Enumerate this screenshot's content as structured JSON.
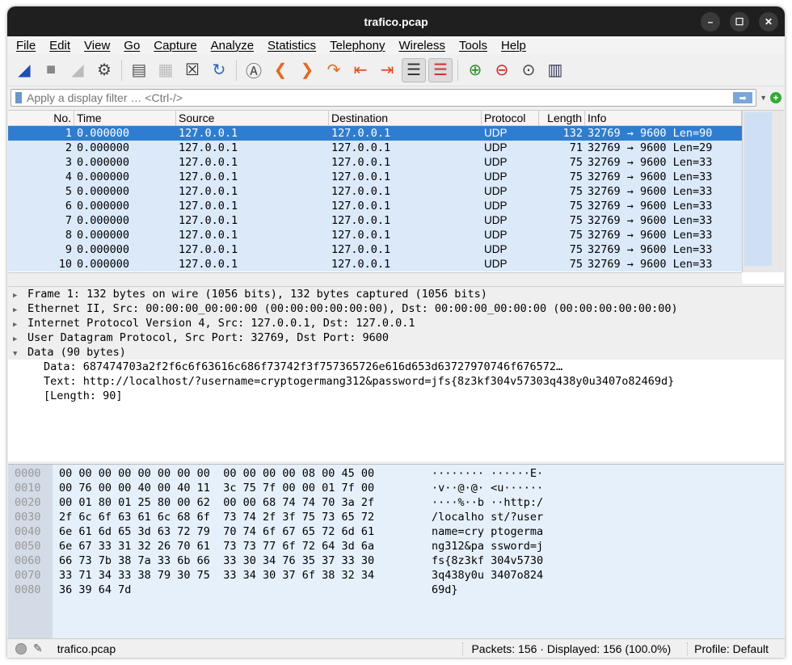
{
  "window": {
    "title": "trafico.pcap"
  },
  "menu": [
    "File",
    "Edit",
    "View",
    "Go",
    "Capture",
    "Analyze",
    "Statistics",
    "Telephony",
    "Wireless",
    "Tools",
    "Help"
  ],
  "filter": {
    "placeholder": "Apply a display filter … <Ctrl-/>"
  },
  "columns": [
    "No.",
    "Time",
    "Source",
    "Destination",
    "Protocol",
    "Length",
    "Info"
  ],
  "packets": [
    [
      "1",
      "0.000000",
      "127.0.0.1",
      "127.0.0.1",
      "UDP",
      "132",
      "32769 → 9600 Len=90"
    ],
    [
      "2",
      "0.000000",
      "127.0.0.1",
      "127.0.0.1",
      "UDP",
      "71",
      "32769 → 9600 Len=29"
    ],
    [
      "3",
      "0.000000",
      "127.0.0.1",
      "127.0.0.1",
      "UDP",
      "75",
      "32769 → 9600 Len=33"
    ],
    [
      "4",
      "0.000000",
      "127.0.0.1",
      "127.0.0.1",
      "UDP",
      "75",
      "32769 → 9600 Len=33"
    ],
    [
      "5",
      "0.000000",
      "127.0.0.1",
      "127.0.0.1",
      "UDP",
      "75",
      "32769 → 9600 Len=33"
    ],
    [
      "6",
      "0.000000",
      "127.0.0.1",
      "127.0.0.1",
      "UDP",
      "75",
      "32769 → 9600 Len=33"
    ],
    [
      "7",
      "0.000000",
      "127.0.0.1",
      "127.0.0.1",
      "UDP",
      "75",
      "32769 → 9600 Len=33"
    ],
    [
      "8",
      "0.000000",
      "127.0.0.1",
      "127.0.0.1",
      "UDP",
      "75",
      "32769 → 9600 Len=33"
    ],
    [
      "9",
      "0.000000",
      "127.0.0.1",
      "127.0.0.1",
      "UDP",
      "75",
      "32769 → 9600 Len=33"
    ],
    [
      "10",
      "0.000000",
      "127.0.0.1",
      "127.0.0.1",
      "UDP",
      "75",
      "32769 → 9600 Len=33"
    ]
  ],
  "details": {
    "top": [
      {
        "text": "Frame 1: 132 bytes on wire (1056 bits), 132 bytes captured (1056 bits)",
        "expanded": false
      },
      {
        "text": "Ethernet II, Src: 00:00:00_00:00:00 (00:00:00:00:00:00), Dst: 00:00:00_00:00:00 (00:00:00:00:00:00)",
        "expanded": false
      },
      {
        "text": "Internet Protocol Version 4, Src: 127.0.0.1, Dst: 127.0.0.1",
        "expanded": false
      },
      {
        "text": "User Datagram Protocol, Src Port: 32769, Dst Port: 9600",
        "expanded": false
      },
      {
        "text": "Data (90 bytes)",
        "expanded": true
      }
    ],
    "sub": [
      "Data: 687474703a2f2f6c6f63616c686f73742f3f757365726e616d653d63727970746f676572…",
      "Text: http://localhost/?username=cryptogermang312&password=jfs{8z3kf304v57303q438y0u3407o82469d}",
      "[Length: 90]"
    ]
  },
  "hex": [
    [
      "0000",
      "00 00 00 00 00 00 00 00  00 00 00 00 08 00 45 00",
      "········ ······E·"
    ],
    [
      "0010",
      "00 76 00 00 40 00 40 11  3c 75 7f 00 00 01 7f 00",
      "·v··@·@· <u······"
    ],
    [
      "0020",
      "00 01 80 01 25 80 00 62  00 00 68 74 74 70 3a 2f",
      "····%··b ··http:/"
    ],
    [
      "0030",
      "2f 6c 6f 63 61 6c 68 6f  73 74 2f 3f 75 73 65 72",
      "/localho st/?user"
    ],
    [
      "0040",
      "6e 61 6d 65 3d 63 72 79  70 74 6f 67 65 72 6d 61",
      "name=cry ptogerma"
    ],
    [
      "0050",
      "6e 67 33 31 32 26 70 61  73 73 77 6f 72 64 3d 6a",
      "ng312&pa ssword=j"
    ],
    [
      "0060",
      "66 73 7b 38 7a 33 6b 66  33 30 34 76 35 37 33 30",
      "fs{8z3kf 304v5730"
    ],
    [
      "0070",
      "33 71 34 33 38 79 30 75  33 34 30 37 6f 38 32 34",
      "3q438y0u 3407o824"
    ],
    [
      "0080",
      "36 39 64 7d",
      "69d}"
    ]
  ],
  "status": {
    "file": "trafico.pcap",
    "packets": "Packets: 156 · Displayed: 156 (100.0%)",
    "profile": "Profile: Default"
  },
  "colors": {
    "selected": "#2f7dd0",
    "udp_row": "#dbe9f9",
    "titlebar": "#1f1f1f"
  }
}
